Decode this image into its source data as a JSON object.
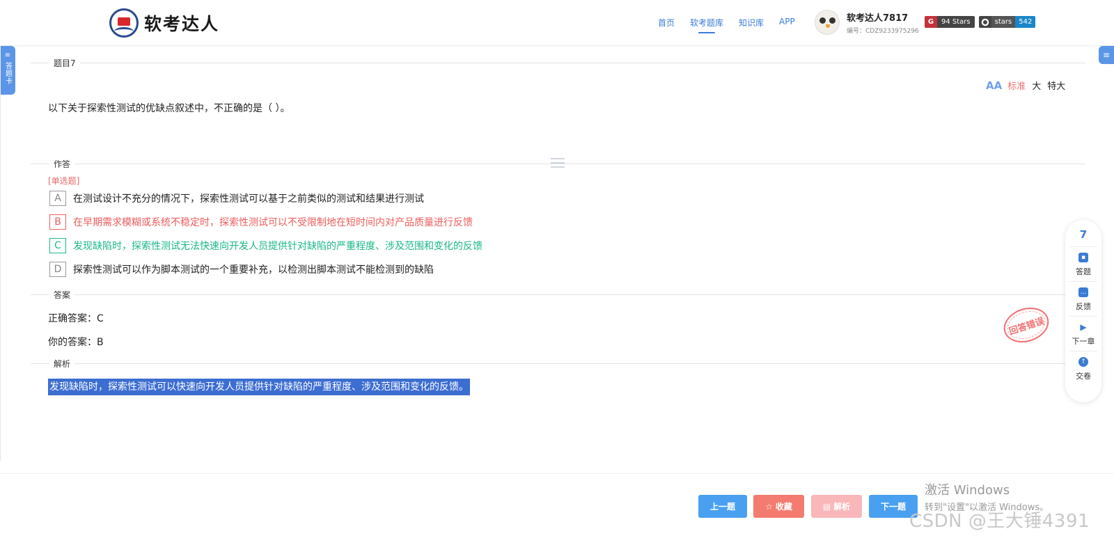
{
  "header": {
    "logo_text": "软考达人",
    "nav": [
      "首页",
      "软考题库",
      "知识库",
      "APP"
    ],
    "active_nav": "软考题库",
    "user_name": "软考达人7817",
    "user_id": "编号：CDZ9233975296",
    "badge_gitee": {
      "icon": "G",
      "text": "94 Stars"
    },
    "badge_github": {
      "label": "stars",
      "count": "542"
    }
  },
  "side": {
    "answer_card": "答题卡"
  },
  "question": {
    "section_title": "题目7",
    "text": "以下关于探索性测试的优缺点叙述中，不正确的是（ ）。",
    "font_size": {
      "options": [
        "标准",
        "大",
        "特大"
      ],
      "selected": "标准"
    }
  },
  "answer_section": {
    "title": "作答",
    "type": "[单选题]",
    "options": [
      {
        "letter": "A",
        "text": "在测试设计不充分的情况下，探索性测试可以基于之前类似的测试和结果进行测试"
      },
      {
        "letter": "B",
        "text": "在早期需求模糊或系统不稳定时，探索性测试可以不受限制地在短时间内对产品质量进行反馈"
      },
      {
        "letter": "C",
        "text": "发现缺陷时，探索性测试无法快速向开发人员提供针对缺陷的严重程度、涉及范围和变化的反馈"
      },
      {
        "letter": "D",
        "text": "探索性测试可以作为脚本测试的一个重要补充，以检测出脚本测试不能检测到的缺陷"
      }
    ]
  },
  "result": {
    "title": "答案",
    "correct": "正确答案：C",
    "yours": "你的答案：B",
    "stamp": "回答错误"
  },
  "analysis": {
    "title": "解析",
    "text": "发现缺陷时，探索性测试可以快速向开发人员提供针对缺陷的严重程度、涉及范围和变化的反馈。"
  },
  "tools": {
    "number": "7",
    "items": [
      "答题",
      "反馈",
      "下一章",
      "交卷"
    ]
  },
  "footer": {
    "prev": "上一题",
    "favorite": "收藏",
    "analysis": "解析",
    "next": "下一题"
  },
  "overlay": {
    "win_line1": "激活 Windows",
    "win_line2": "转到\"设置\"以激活 Windows。",
    "csdn": "CSDN @王大锤4391"
  },
  "colors": {
    "accent": "#3a7bd5",
    "wrong": "#ec5d5d",
    "right": "#19b886",
    "highlight": "#3c6dd1"
  }
}
